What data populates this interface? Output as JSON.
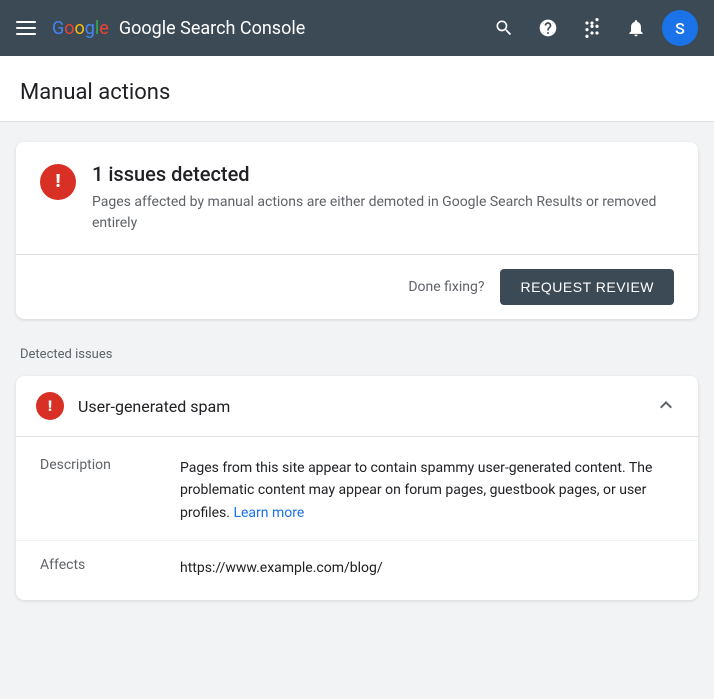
{
  "nav": {
    "hamburger_label": "Menu",
    "logo_text": "Google Search Console",
    "icons": [
      {
        "name": "search-icon",
        "symbol": "🔍"
      },
      {
        "name": "help-icon",
        "symbol": "?"
      },
      {
        "name": "apps-icon",
        "symbol": "⊞"
      },
      {
        "name": "notifications-icon",
        "symbol": "🔔"
      }
    ],
    "avatar_letter": "S"
  },
  "page": {
    "title": "Manual actions"
  },
  "summary_card": {
    "issues_count": "1 issues detected",
    "description": "Pages affected by manual actions are either demoted in Google Search Results or removed entirely",
    "done_fixing_label": "Done fixing?",
    "request_review_label": "REQUEST REVIEW"
  },
  "detected_section": {
    "label": "Detected issues"
  },
  "issue": {
    "title": "User-generated spam",
    "description_label": "Description",
    "description_text": "Pages from this site appear to contain spammy user-generated content. The problematic content may appear on forum pages, guestbook pages, or user profiles.",
    "learn_more_label": "Learn more",
    "learn_more_href": "#",
    "affects_label": "Affects",
    "affects_url": "https://www.example.com/blog/"
  }
}
